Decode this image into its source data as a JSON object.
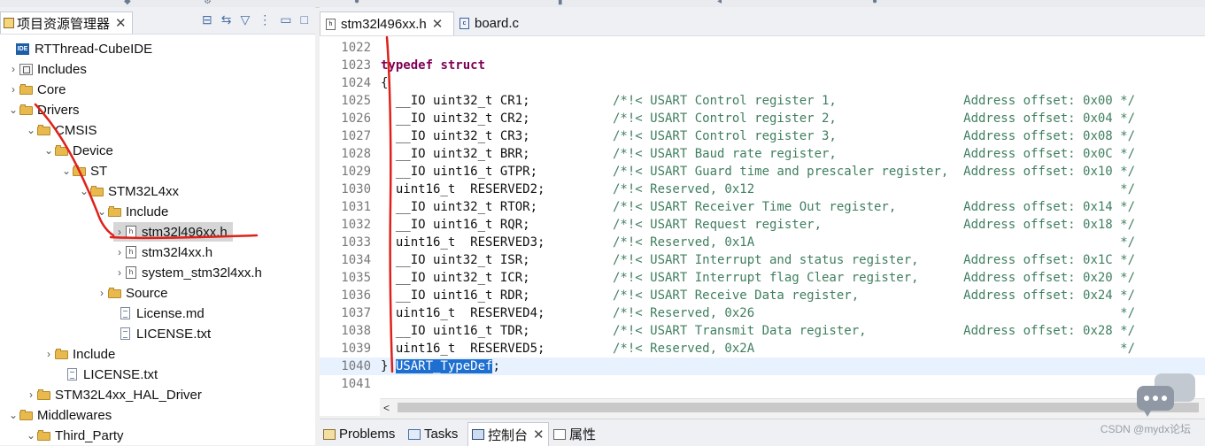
{
  "explorer": {
    "tab_title": "项目资源管理器",
    "tab_close": "✕",
    "tree": [
      {
        "label": "RTThread-CubeIDE",
        "type": "project"
      },
      {
        "label": "Includes",
        "type": "includes"
      },
      {
        "label": "Core",
        "type": "folder"
      },
      {
        "label": "Drivers",
        "type": "folder"
      },
      {
        "label": "CMSIS",
        "type": "folder"
      },
      {
        "label": "Device",
        "type": "folder"
      },
      {
        "label": "ST",
        "type": "folder"
      },
      {
        "label": "STM32L4xx",
        "type": "folder"
      },
      {
        "label": "Include",
        "type": "folder"
      },
      {
        "label": "stm32l496xx.h",
        "type": "header",
        "selected": true
      },
      {
        "label": "stm32l4xx.h",
        "type": "header"
      },
      {
        "label": "system_stm32l4xx.h",
        "type": "header"
      },
      {
        "label": "Source",
        "type": "folder"
      },
      {
        "label": "License.md",
        "type": "text"
      },
      {
        "label": "LICENSE.txt",
        "type": "text"
      },
      {
        "label": "Include",
        "type": "folder"
      },
      {
        "label": "LICENSE.txt",
        "type": "text"
      },
      {
        "label": "STM32L4xx_HAL_Driver",
        "type": "folder"
      },
      {
        "label": "Middlewares",
        "type": "folder"
      },
      {
        "label": "Third_Party",
        "type": "folder"
      }
    ]
  },
  "editor": {
    "tabs": [
      {
        "label": "stm32l496xx.h",
        "close": "✕",
        "active": true
      },
      {
        "label": "board.c",
        "active": false
      }
    ],
    "lines": [
      {
        "n": "1022",
        "code": ""
      },
      {
        "n": "1023",
        "code": "typedef struct"
      },
      {
        "n": "1024",
        "code": "{"
      },
      {
        "n": "1025",
        "code": "  __IO uint32_t CR1;",
        "comment": "/*!< USART Control register 1,                 Address offset: 0x00 */"
      },
      {
        "n": "1026",
        "code": "  __IO uint32_t CR2;",
        "comment": "/*!< USART Control register 2,                 Address offset: 0x04 */"
      },
      {
        "n": "1027",
        "code": "  __IO uint32_t CR3;",
        "comment": "/*!< USART Control register 3,                 Address offset: 0x08 */"
      },
      {
        "n": "1028",
        "code": "  __IO uint32_t BRR;",
        "comment": "/*!< USART Baud rate register,                 Address offset: 0x0C */"
      },
      {
        "n": "1029",
        "code": "  __IO uint16_t GTPR;",
        "comment": "/*!< USART Guard time and prescaler register,  Address offset: 0x10 */"
      },
      {
        "n": "1030",
        "code": "  uint16_t  RESERVED2;",
        "comment": "/*!< Reserved, 0x12                                                 */"
      },
      {
        "n": "1031",
        "code": "  __IO uint32_t RTOR;",
        "comment": "/*!< USART Receiver Time Out register,         Address offset: 0x14 */"
      },
      {
        "n": "1032",
        "code": "  __IO uint16_t RQR;",
        "comment": "/*!< USART Request register,                   Address offset: 0x18 */"
      },
      {
        "n": "1033",
        "code": "  uint16_t  RESERVED3;",
        "comment": "/*!< Reserved, 0x1A                                                 */"
      },
      {
        "n": "1034",
        "code": "  __IO uint32_t ISR;",
        "comment": "/*!< USART Interrupt and status register,      Address offset: 0x1C */"
      },
      {
        "n": "1035",
        "code": "  __IO uint32_t ICR;",
        "comment": "/*!< USART Interrupt flag Clear register,      Address offset: 0x20 */"
      },
      {
        "n": "1036",
        "code": "  __IO uint16_t RDR;",
        "comment": "/*!< USART Receive Data register,              Address offset: 0x24 */"
      },
      {
        "n": "1037",
        "code": "  uint16_t  RESERVED4;",
        "comment": "/*!< Reserved, 0x26                                                 */"
      },
      {
        "n": "1038",
        "code": "  __IO uint16_t TDR;",
        "comment": "/*!< USART Transmit Data register,             Address offset: 0x28 */"
      },
      {
        "n": "1039",
        "code": "  uint16_t  RESERVED5;",
        "comment": "/*!< Reserved, 0x2A                                                 */"
      },
      {
        "n": "1040",
        "code": "} ",
        "selected": "USART_TypeDef",
        "after": ";",
        "current": true
      },
      {
        "n": "1041",
        "code": ""
      }
    ],
    "hscroll_left": "<"
  },
  "bottom_panel": {
    "tabs": [
      {
        "label": "Problems",
        "icon": "problems-icon"
      },
      {
        "label": "Tasks",
        "icon": "tasks-icon"
      },
      {
        "label": "控制台",
        "icon": "console-icon",
        "close": "✕",
        "active": true
      },
      {
        "label": "属性",
        "icon": "properties-icon"
      }
    ]
  },
  "watermark": "CSDN @mydx论坛",
  "colors": {
    "keyword": "#7f0055",
    "comment": "#3f7f5f",
    "selection": "#1e6fd0",
    "annotation": "#e0201a"
  }
}
